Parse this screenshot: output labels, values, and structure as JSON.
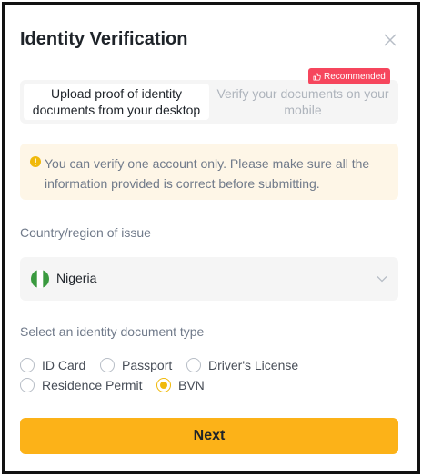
{
  "dialog": {
    "title": "Identity Verification",
    "close_icon": "close-icon"
  },
  "tabs": [
    {
      "label": "Upload proof of identity documents from your desktop",
      "active": true
    },
    {
      "label": "Verify your documents on your mobile",
      "active": false
    }
  ],
  "badge": {
    "label": "Recommended",
    "icon": "thumbs-up-icon",
    "color": "#f6465d"
  },
  "notice": {
    "icon": "warning-icon",
    "text": "You can verify one account only. Please make sure all the information provided is correct before submitting."
  },
  "country": {
    "label": "Country/region of issue",
    "value": "Nigeria",
    "flag": "nigeria-flag-icon"
  },
  "document_type": {
    "label": "Select an identity document type",
    "options": [
      {
        "label": "ID Card",
        "selected": false
      },
      {
        "label": "Passport",
        "selected": false
      },
      {
        "label": "Driver's License",
        "selected": false
      },
      {
        "label": "Residence Permit",
        "selected": false
      },
      {
        "label": "BVN",
        "selected": true
      }
    ]
  },
  "next_button": {
    "label": "Next",
    "color": "#fcb218"
  },
  "colors": {
    "accent": "#f0b90b",
    "notice_bg": "#fef6e7",
    "tab_bg": "#f5f5f5"
  }
}
